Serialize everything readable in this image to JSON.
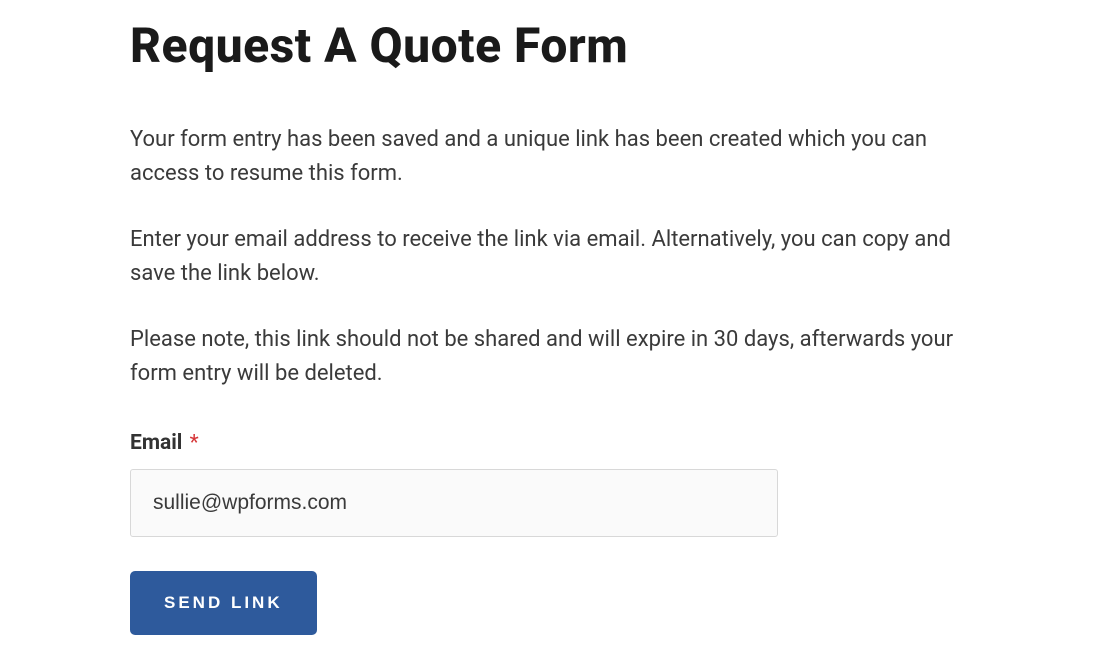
{
  "title": "Request A Quote Form",
  "paragraphs": {
    "p1": "Your form entry has been saved and a unique link has been created which you can access to resume this form.",
    "p2": "Enter your email address to receive the link via email. Alternatively, you can copy and save the link below.",
    "p3": "Please note, this link should not be shared and will expire in 30 days, afterwards your form entry will be deleted."
  },
  "form": {
    "email_label": "Email",
    "required_mark": "*",
    "email_value": "sullie@wpforms.com",
    "send_button_label": "SEND LINK"
  }
}
